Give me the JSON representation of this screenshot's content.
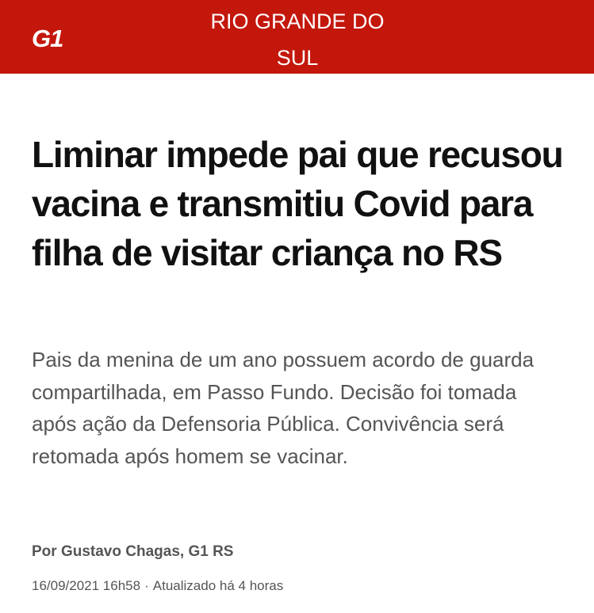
{
  "header": {
    "logo": "G1",
    "section": "RIO GRANDE DO SUL",
    "background_color": "#c4170c"
  },
  "article": {
    "headline": "Liminar impede pai que recusou vacina e transmitiu Covid para filha de visitar criança no RS",
    "subtitle": "Pais da menina de um ano possuem acordo de guarda compartilhada, em Passo Fundo. Decisão foi tomada após ação da Defensoria Pública. Convivência será retomada após homem se vacinar.",
    "byline": "Por Gustavo Chagas, G1 RS",
    "published": "16/09/2021 16h58",
    "separator": "·",
    "updated": "Atualizado há 4 horas"
  }
}
